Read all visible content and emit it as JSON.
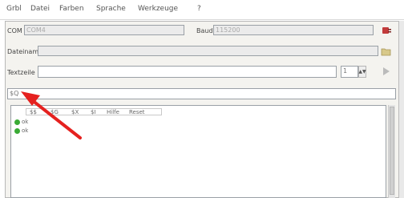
{
  "menu": {
    "items": [
      "Grbl",
      "Datei",
      "Farben",
      "Sprache",
      "Werkzeuge",
      "?"
    ]
  },
  "connection": {
    "com_label": "COM",
    "com_value": "COM4",
    "baud_label": "Baud",
    "baud_value": "115200"
  },
  "file": {
    "label": "Dateiname",
    "value": ""
  },
  "text": {
    "label": "Textzeile",
    "value": "",
    "spinner_value": "1"
  },
  "command": {
    "value": "$Q"
  },
  "log": {
    "columns": [
      "$$",
      "$G",
      "$X",
      "$I",
      "Hilfe",
      "Reset"
    ],
    "entries": [
      "ok",
      "ok"
    ]
  },
  "colors": {
    "arrow": "#e5211f",
    "ok_icon": "#3aaa35"
  },
  "icons": {
    "connect": "plug-icon",
    "open_file": "folder-icon",
    "send": "send-arrow-icon",
    "status_ok": "check-circle-icon",
    "annotation": "red-arrow"
  }
}
